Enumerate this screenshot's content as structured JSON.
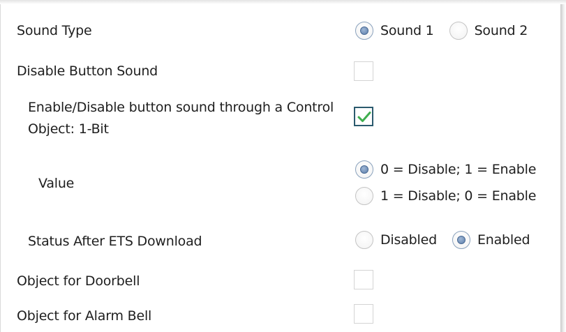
{
  "sound_type": {
    "label": "Sound Type",
    "options": [
      {
        "label": "Sound 1",
        "selected": true
      },
      {
        "label": "Sound 2",
        "selected": false
      }
    ]
  },
  "disable_button_sound": {
    "label": "Disable Button Sound",
    "checked": false
  },
  "enable_disable_control_object": {
    "label": "Enable/Disable button sound through a Control Object: 1-Bit",
    "checked": true
  },
  "value": {
    "label": "Value",
    "options": [
      {
        "label": "0 = Disable; 1 = Enable",
        "selected": true
      },
      {
        "label": "1 = Disable; 0 = Enable",
        "selected": false
      }
    ]
  },
  "status_after_ets_download": {
    "label": "Status After ETS Download",
    "options": [
      {
        "label": "Disabled",
        "selected": false
      },
      {
        "label": "Enabled",
        "selected": true
      }
    ]
  },
  "object_for_doorbell": {
    "label": "Object for Doorbell",
    "checked": false
  },
  "object_for_alarm_bell": {
    "label": "Object for Alarm Bell",
    "checked": false
  },
  "colors": {
    "radio_selected": "#5d7fab",
    "checkmark": "#3fae4f",
    "checkbox_checked_border": "#2b5a6e"
  }
}
